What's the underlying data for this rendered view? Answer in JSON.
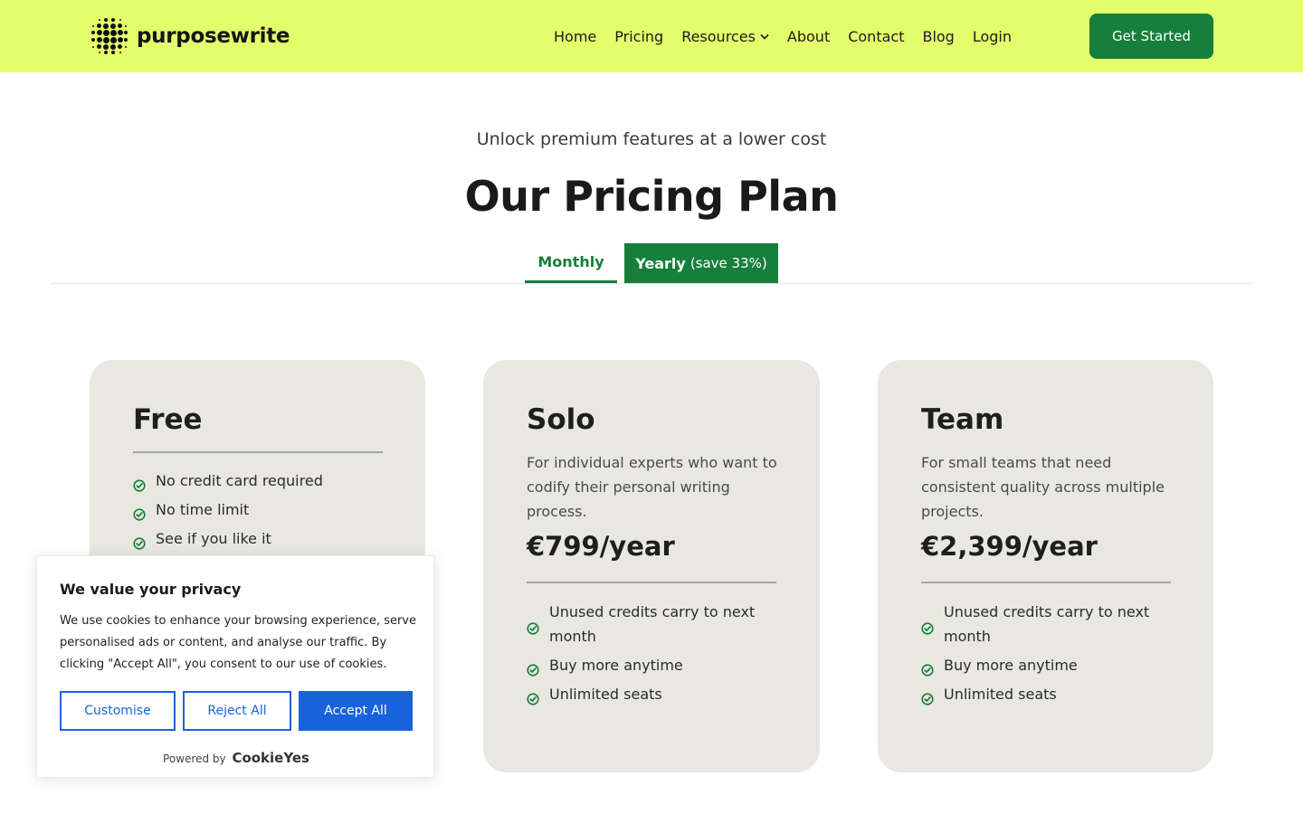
{
  "header": {
    "logo_text": "purposewrite",
    "nav": [
      {
        "label": "Home"
      },
      {
        "label": "Pricing"
      },
      {
        "label": "Resources"
      },
      {
        "label": "About"
      },
      {
        "label": "Contact"
      },
      {
        "label": "Blog"
      },
      {
        "label": "Login"
      }
    ],
    "cta_label": "Get Started"
  },
  "hero": {
    "eyebrow": "Unlock premium features at a lower cost",
    "title": "Our Pricing Plan"
  },
  "billing_tabs": {
    "monthly_label": "Monthly",
    "yearly_label": "Yearly",
    "yearly_note": "(save 33%)",
    "active": "yearly"
  },
  "plans": [
    {
      "name": "Free",
      "features": [
        "No credit card required",
        "No time limit",
        "See if you like it"
      ]
    },
    {
      "name": "Solo",
      "description": "For individual experts who want to codify their personal writing process.",
      "price": "€799/year",
      "features": [
        "Unused credits carry to next month",
        "Buy more anytime",
        "Unlimited seats"
      ]
    },
    {
      "name": "Team",
      "description": "For small teams that need consistent quality across multiple projects.",
      "price": "€2,399/year",
      "features": [
        "Unused credits carry to next month",
        "Buy more anytime",
        "Unlimited seats"
      ]
    }
  ],
  "cookie_banner": {
    "title": "We value your privacy",
    "text": "We use cookies to enhance your browsing experience, serve personalised ads or content, and analyse our traffic. By clicking \"Accept All\", you consent to our use of cookies.",
    "customise_label": "Customise",
    "reject_label": "Reject All",
    "accept_label": "Accept All",
    "powered_by": "Powered by",
    "brand": "CookieYes"
  },
  "colors": {
    "header_bg": "#e3fd6b",
    "brand_green": "#177f3c",
    "card_bg": "#e8e8e0",
    "cookie_blue": "#1863dc"
  },
  "icons": {
    "feature_check": "check-circle-icon",
    "dropdown": "chevron-down-icon",
    "logo": "dot-grid-logo-icon"
  }
}
